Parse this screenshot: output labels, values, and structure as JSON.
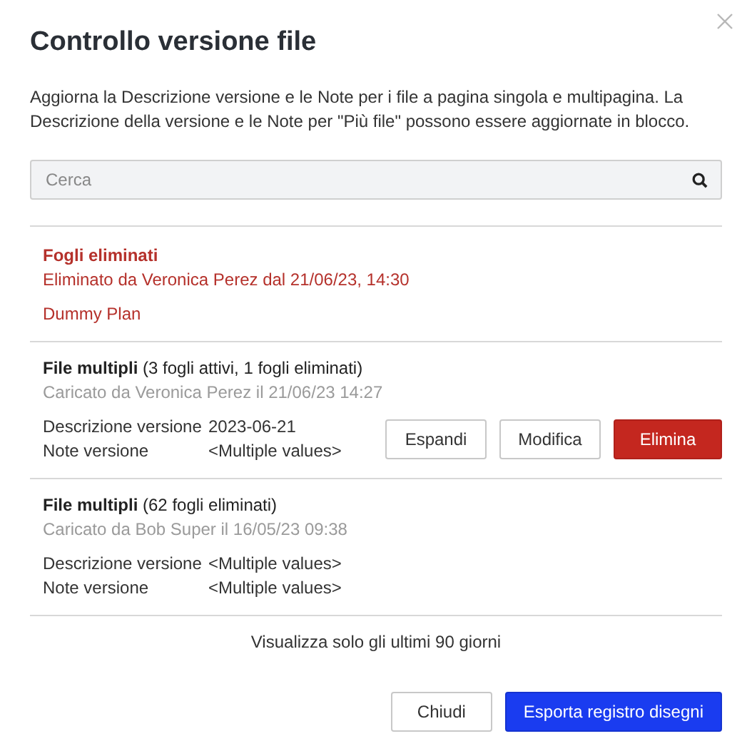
{
  "dialog": {
    "title": "Controllo versione file",
    "description": "Aggiorna la Descrizione versione e le Note per i file a pagina singola e multipagina. La Descrizione della versione e le Note per \"Più file\" possono essere aggiornate in blocco."
  },
  "search": {
    "placeholder": "Cerca"
  },
  "groups": [
    {
      "kind": "deleted",
      "title": "Fogli eliminati",
      "subtitle": "Eliminato da Veronica Perez dal 21/06/23, 14:30",
      "files": [
        "Dummy Plan"
      ]
    },
    {
      "kind": "multi",
      "title": "File multipli",
      "detail": "(3 fogli attivi, 1 fogli eliminati)",
      "subtitle": "Caricato da Veronica Perez il 21/06/23 14:27",
      "fields": [
        {
          "label": "Descrizione versione",
          "value": "2023-06-21"
        },
        {
          "label": "Note versione",
          "value": "<Multiple values>"
        }
      ],
      "actions": [
        {
          "label": "Espandi",
          "kind": "default"
        },
        {
          "label": "Modifica",
          "kind": "default"
        },
        {
          "label": "Elimina",
          "kind": "danger"
        }
      ]
    },
    {
      "kind": "multi",
      "title": "File multipli",
      "detail": "(62 fogli eliminati)",
      "subtitle": "Caricato da Bob Super il 16/05/23 09:38",
      "fields": [
        {
          "label": "Descrizione versione",
          "value": "<Multiple values>"
        },
        {
          "label": "Note versione",
          "value": "<Multiple values>"
        }
      ]
    }
  ],
  "footer_note": "Visualizza solo gli ultimi 90 giorni",
  "buttons": [
    {
      "label": "Chiudi",
      "kind": "default"
    },
    {
      "label": "Esporta registro disegni",
      "kind": "primary"
    }
  ]
}
